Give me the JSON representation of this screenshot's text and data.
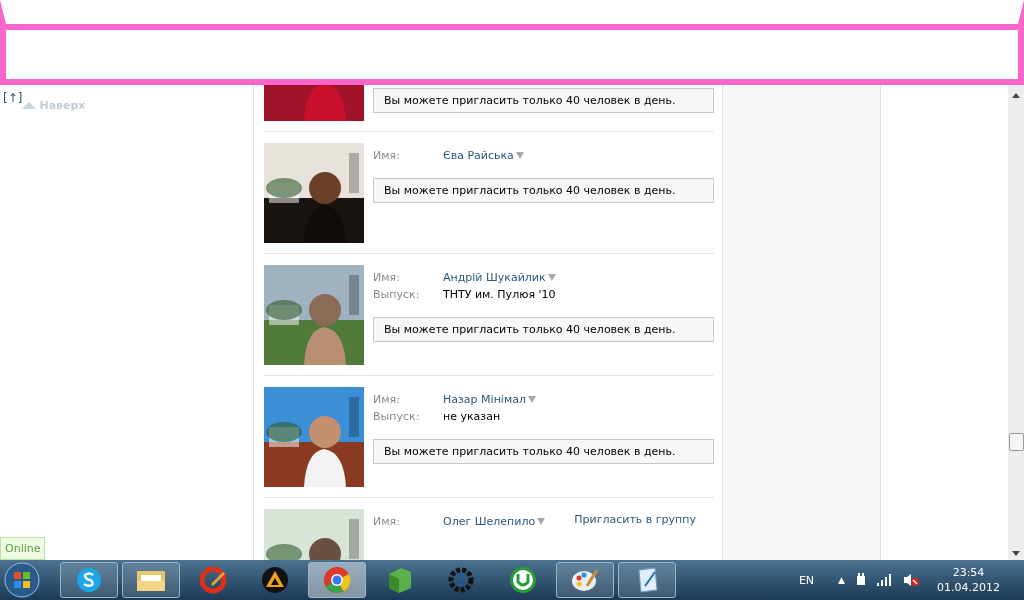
{
  "back_to_top": {
    "bracket": "[↑]",
    "label": "Наверх"
  },
  "people": [
    {
      "action": {
        "kind": "notice",
        "text": "Вы можете пригласить только 40 человек в день."
      }
    },
    {
      "fields": [
        {
          "kind": "name",
          "label": "Имя:",
          "value": "Єва Райська"
        }
      ],
      "action": {
        "kind": "notice",
        "text": "Вы можете пригласить только 40 человек в день."
      }
    },
    {
      "fields": [
        {
          "kind": "name",
          "label": "Имя:",
          "value": "Андрій Шукайлик"
        },
        {
          "kind": "text",
          "label": "Выпуск:",
          "value": "ТНТУ им. Пулюя '10"
        }
      ],
      "action": {
        "kind": "notice",
        "text": "Вы можете пригласить только 40 человек в день."
      }
    },
    {
      "fields": [
        {
          "kind": "name",
          "label": "Имя:",
          "value": "Назар Мінімал"
        },
        {
          "kind": "text",
          "label": "Выпуск:",
          "value": "не указан"
        }
      ],
      "action": {
        "kind": "notice",
        "text": "Вы можете пригласить только 40 человек в день."
      }
    },
    {
      "fields": [
        {
          "kind": "name",
          "label": "Имя:",
          "value": "Олег Шелепило"
        }
      ],
      "action": {
        "kind": "link",
        "text": "Пригласить в группу"
      }
    }
  ],
  "status_badge": "Online",
  "taskbar": {
    "items": [
      {
        "kind": "skype",
        "running": true,
        "selected": false
      },
      {
        "kind": "folder",
        "running": true,
        "selected": false
      },
      {
        "kind": "cleaner",
        "running": false,
        "selected": false
      },
      {
        "kind": "player",
        "running": false,
        "selected": false
      },
      {
        "kind": "browser",
        "running": true,
        "selected": true
      },
      {
        "kind": "box",
        "running": false,
        "selected": false
      },
      {
        "kind": "gear",
        "running": false,
        "selected": false
      },
      {
        "kind": "torrent",
        "running": false,
        "selected": false
      },
      {
        "kind": "paint",
        "running": true,
        "selected": false
      },
      {
        "kind": "notepad",
        "running": true,
        "selected": false
      }
    ],
    "tray": {
      "language": "EN",
      "expand": "▲",
      "time": "23:54",
      "date": "01.04.2012"
    }
  }
}
